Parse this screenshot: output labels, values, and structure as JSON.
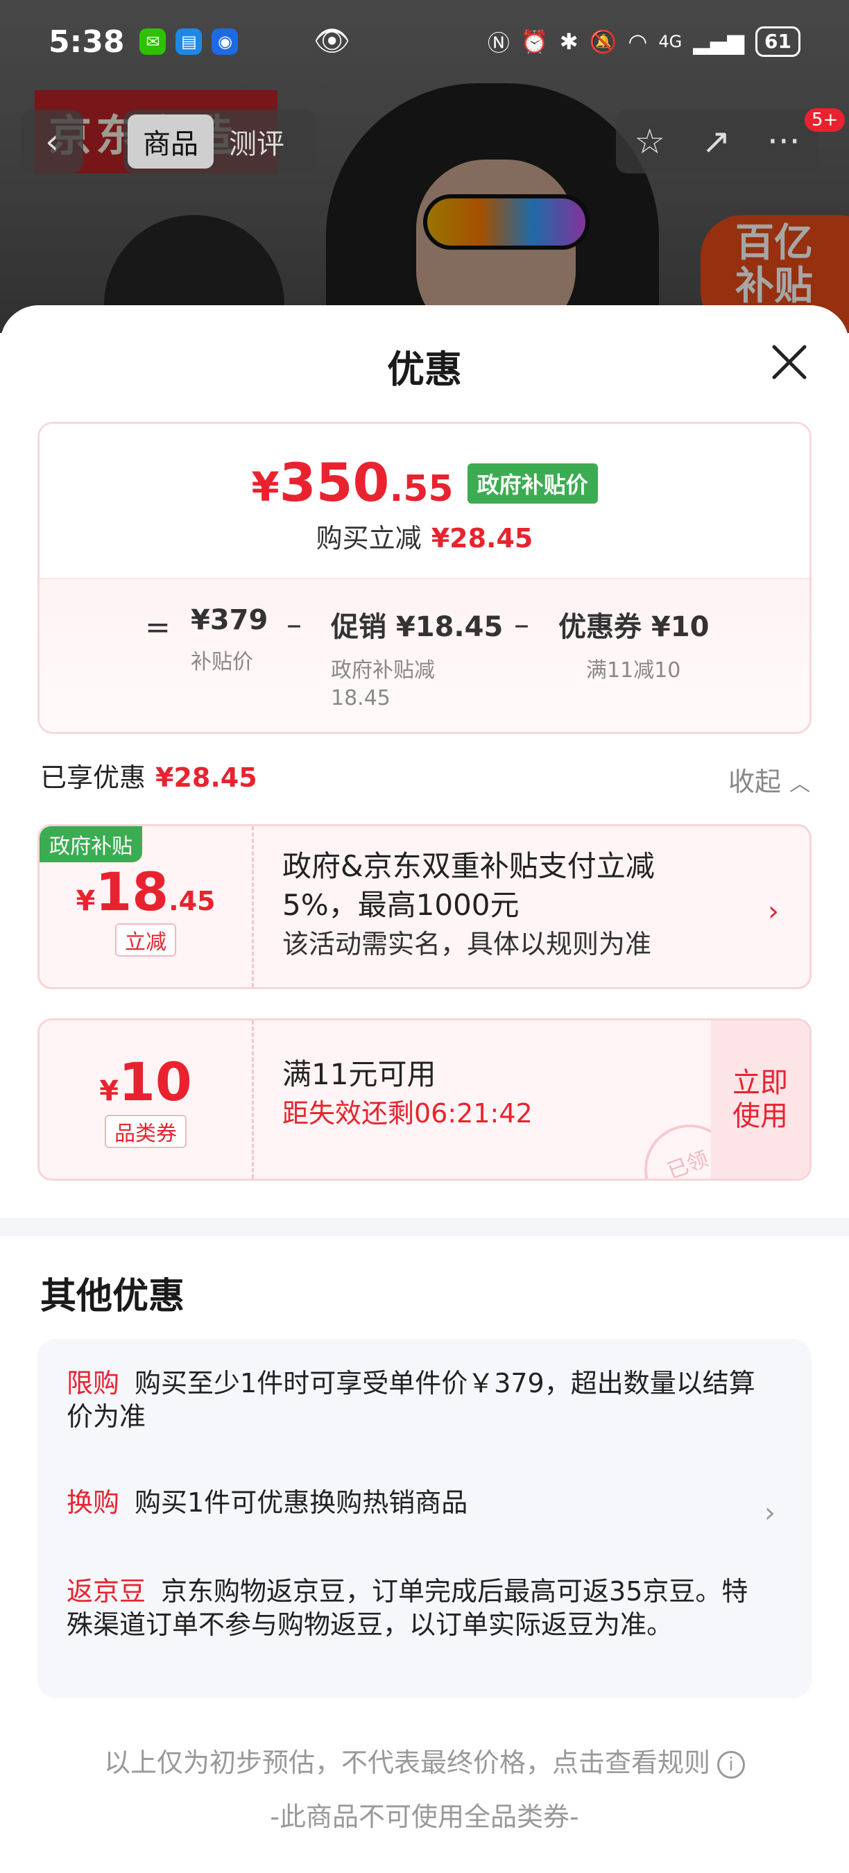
{
  "status_bar": {
    "time": "5:38",
    "network": "4G",
    "battery": "61"
  },
  "background": {
    "brand": "京东京造",
    "subsidy_badge": "百亿补贴"
  },
  "top_nav": {
    "tabs": [
      "商品",
      "测评"
    ],
    "active_tab": "商品",
    "message_count": "5+"
  },
  "sheet": {
    "title": "优惠",
    "price_summary": {
      "yen": "¥",
      "price_int": "350",
      "price_dec": ".55",
      "tag": "政府补贴价",
      "discount_label": "购买立减",
      "discount_amount": "¥28.45",
      "eq": "=",
      "base_price": "¥379",
      "base_label": "补贴价",
      "minus": "–",
      "promo": "促销 ¥18.45",
      "promo_sub_1": "政府补贴减",
      "promo_sub_2": "18.45",
      "coupon": "优惠券 ¥10",
      "coupon_sub": "满11减10"
    },
    "enjoyed": {
      "label": "已享优惠",
      "amount": "¥28.45",
      "collapse": "收起"
    },
    "coupons": [
      {
        "corner_tag": "政府补贴",
        "yen": "¥",
        "amount_int": "18",
        "amount_dec": ".45",
        "type": "立减",
        "line1": "政府&京东双重补贴支付立减",
        "line2": "5%，最高1000元",
        "line3": "该活动需实名，具体以规则为准"
      },
      {
        "yen": "¥",
        "amount_int": "10",
        "type": "品类券",
        "line1": "满11元可用",
        "timer": "距失效还剩06:21:42",
        "button": "立即使用",
        "stamp": "已领"
      }
    ],
    "other": {
      "title": "其他优惠",
      "rows": [
        {
          "tag": "限购",
          "text": "购买至少1件时可享受单件价￥379，超出数量以结算价为准"
        },
        {
          "tag": "换购",
          "text": "购买1件可优惠换购热销商品"
        },
        {
          "tag": "返京豆",
          "text": "京东购物返京豆，订单完成后最高可返35京豆。特殊渠道订单不参与购物返豆，以订单实际返豆为准。"
        }
      ]
    },
    "footer": {
      "note": "以上仅为初步预估，不代表最终价格，点击查看规则",
      "sub": "-此商品不可使用全品类券-"
    }
  }
}
